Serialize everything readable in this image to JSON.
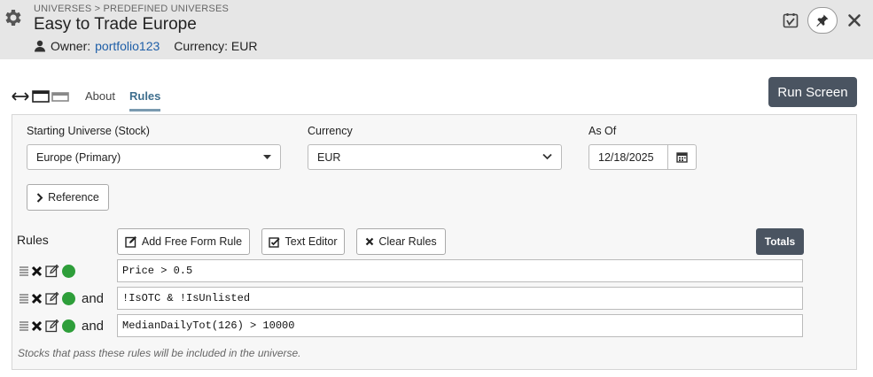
{
  "header": {
    "breadcrumb": "UNIVERSES > PREDEFINED UNIVERSES",
    "title": "Easy to Trade Europe",
    "owner_label": "Owner:",
    "owner_value": "portfolio123",
    "currency_text": "Currency: EUR",
    "icons": [
      "gear-icon",
      "user-icon",
      "save-icon",
      "pin-icon",
      "close-icon"
    ]
  },
  "tabs": [
    {
      "label": "About",
      "active": false
    },
    {
      "label": "Rules",
      "active": true
    }
  ],
  "run_button": "Run Screen",
  "form": {
    "starting_universe": {
      "label": "Starting Universe (Stock)",
      "value": "Europe (Primary)"
    },
    "currency": {
      "label": "Currency",
      "value": "EUR"
    },
    "as_of": {
      "label": "As Of",
      "value": "12/18/2025"
    },
    "reference_button": "Reference"
  },
  "rules_section": {
    "label": "Rules",
    "add_free_form": "Add Free Form Rule",
    "text_editor": "Text Editor",
    "clear_rules": "Clear Rules",
    "totals": "Totals",
    "rules": [
      {
        "connector": "",
        "expression": "Price > 0.5",
        "status": "ok"
      },
      {
        "connector": "and",
        "expression": "!IsOTC & !IsUnlisted",
        "status": "ok"
      },
      {
        "connector": "and",
        "expression": "MedianDailyTot(126) > 10000",
        "status": "ok"
      }
    ],
    "footnote": "Stocks that pass these rules will be included in the universe."
  },
  "colors": {
    "header_bg": "#e6e6e6",
    "accent_dark": "#4a5461",
    "link": "#1f5fa8",
    "status_ok": "#2e9e3a"
  }
}
